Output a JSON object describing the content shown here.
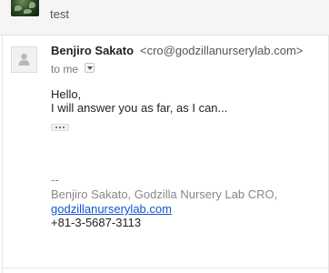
{
  "previous_message": {
    "sender": "",
    "snippet": "test"
  },
  "message": {
    "sender_name": "Benjiro Sakato",
    "sender_email": "<cro@godzillanurserylab.com>",
    "to_label": "to me",
    "body": {
      "line1": "Hello,",
      "line2": "I will answer you as far, as I can..."
    },
    "signature": {
      "dash": "--",
      "name_line": "Benjiro Sakato, Godzilla Nursery Lab CRO,",
      "website": "godzillanurserylab.com",
      "phone": "+81-3-5687-3113"
    }
  },
  "icons": {
    "avatar": "person-icon",
    "recipients": "chevron-down-icon",
    "trimmed": "ellipsis-icon"
  },
  "colors": {
    "link": "#1155cc",
    "signature": "#888888",
    "header_bg": "#f5f5f5"
  }
}
